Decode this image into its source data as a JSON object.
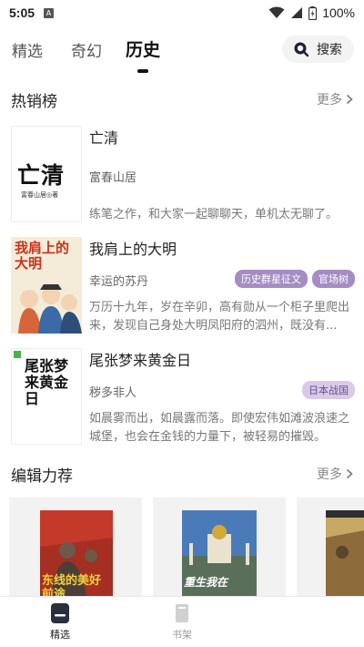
{
  "status_bar": {
    "time": "5:05",
    "notif_letter": "A",
    "battery": "100%"
  },
  "tabs": [
    {
      "label": "精选"
    },
    {
      "label": "奇幻"
    },
    {
      "label": "历史"
    }
  ],
  "search": {
    "label": "搜索"
  },
  "hot": {
    "title": "热销榜",
    "more": "更多",
    "books": [
      {
        "title": "亡清",
        "author": "富春山居",
        "tags": [],
        "desc": "练笔之作，和大家一起聊聊天，单机太无聊了。",
        "cover_text": "亡清",
        "cover_sub": "富春山居◎著"
      },
      {
        "title": "我肩上的大明",
        "author": "幸运的苏丹",
        "tags": [
          "历史群星征文",
          "官场树"
        ],
        "desc": "万历十九年，岁在辛卯，高有勋从一个柜子里爬出来，发现自己身处大明凤阳府的泗州，既没有...",
        "cover_text": "我肩上的大明"
      },
      {
        "title": "尾张梦来黄金日",
        "author": "秽多非人",
        "tags": [
          "日本战国"
        ],
        "desc": "如晨雾而出，如晨露而落。即使宏伟如滩波浪速之城堡，也会在金钱的力量下，被轻易的摧毁。",
        "cover_text": "尾张梦来黄金日"
      }
    ]
  },
  "editor": {
    "title": "编辑力荐",
    "more": "更多",
    "covers": [
      {
        "text": "东线的美好前途"
      },
      {
        "text": "重生我在"
      },
      {
        "text": ""
      }
    ]
  },
  "bottom_nav": [
    {
      "label": "精选"
    },
    {
      "label": "书架"
    }
  ],
  "colors": {
    "tag_purple": "#a58cc2",
    "tag_light": "#d9cbe8",
    "text_gray": "#777777"
  }
}
